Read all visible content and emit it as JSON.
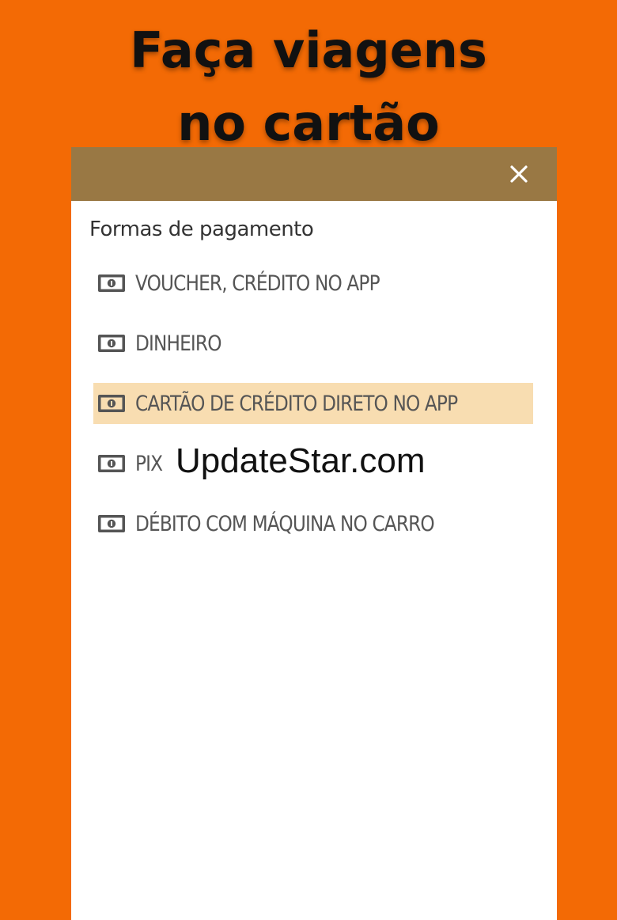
{
  "promo": {
    "line1": "Faça viagens",
    "line2": "no cartão"
  },
  "modal": {
    "close_icon": "close-icon",
    "section_title": "Formas de pagamento",
    "payment_methods": [
      {
        "label": "VOUCHER, CRÉDITO NO APP",
        "icon": "money-icon",
        "selected": false
      },
      {
        "label": "DINHEIRO",
        "icon": "money-icon",
        "selected": false
      },
      {
        "label": "CARTÃO DE CRÉDITO DIRETO NO APP",
        "icon": "money-icon",
        "selected": true
      },
      {
        "label": "PIX",
        "icon": "money-icon",
        "selected": false
      },
      {
        "label": "DÉBITO COM MÁQUINA NO CARRO",
        "icon": "money-icon",
        "selected": false
      }
    ]
  },
  "watermark": "UpdateStar.com",
  "colors": {
    "background": "#f36a05",
    "header": "#997844",
    "selected_row": "#f8ddb1",
    "panel": "#ffffff"
  }
}
